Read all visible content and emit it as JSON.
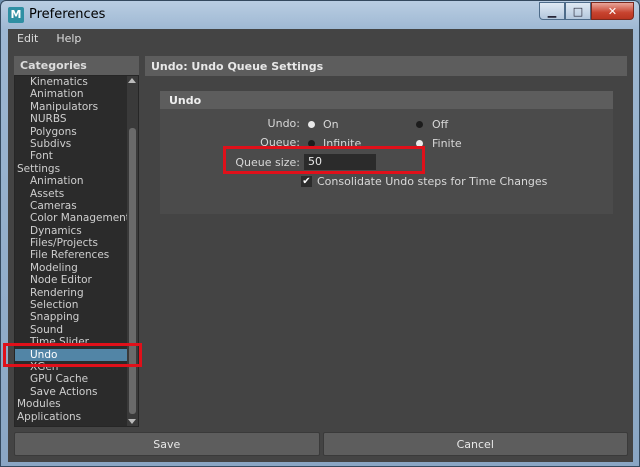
{
  "window": {
    "title": "Preferences",
    "app_icon_letter": "M",
    "buttons": {
      "minimize": "▁",
      "maximize": "□",
      "close": "✕"
    }
  },
  "menubar": {
    "items": [
      "Edit",
      "Help"
    ]
  },
  "categories": {
    "header": "Categories",
    "items": [
      {
        "label": "Kinematics",
        "level": 1
      },
      {
        "label": "Animation",
        "level": 1
      },
      {
        "label": "Manipulators",
        "level": 1
      },
      {
        "label": "NURBS",
        "level": 1
      },
      {
        "label": "Polygons",
        "level": 1
      },
      {
        "label": "Subdivs",
        "level": 1
      },
      {
        "label": "Font",
        "level": 1
      },
      {
        "label": "Settings",
        "level": 0
      },
      {
        "label": "Animation",
        "level": 1
      },
      {
        "label": "Assets",
        "level": 1
      },
      {
        "label": "Cameras",
        "level": 1
      },
      {
        "label": "Color Management",
        "level": 1
      },
      {
        "label": "Dynamics",
        "level": 1
      },
      {
        "label": "Files/Projects",
        "level": 1
      },
      {
        "label": "File References",
        "level": 1
      },
      {
        "label": "Modeling",
        "level": 1
      },
      {
        "label": "Node Editor",
        "level": 1
      },
      {
        "label": "Rendering",
        "level": 1
      },
      {
        "label": "Selection",
        "level": 1
      },
      {
        "label": "Snapping",
        "level": 1
      },
      {
        "label": "Sound",
        "level": 1
      },
      {
        "label": "Time Slider",
        "level": 1
      },
      {
        "label": "Undo",
        "level": 1,
        "selected": true
      },
      {
        "label": "XGen",
        "level": 1
      },
      {
        "label": "GPU Cache",
        "level": 1
      },
      {
        "label": "Save Actions",
        "level": 1
      },
      {
        "label": "Modules",
        "level": 0
      },
      {
        "label": "Applications",
        "level": 0
      }
    ]
  },
  "settings": {
    "header": "Undo: Undo Queue Settings",
    "frame_title": "Undo",
    "undo_label": "Undo:",
    "undo_on": "On",
    "undo_off": "Off",
    "undo_selected": "On",
    "queue_label": "Queue:",
    "queue_infinite": "Infinite",
    "queue_finite": "Finite",
    "queue_selected": "Finite",
    "queue_size_label": "Queue size:",
    "queue_size_value": "50",
    "consolidate_label": "Consolidate Undo steps for Time Changes",
    "consolidate_checked": true
  },
  "buttons": {
    "save": "Save",
    "cancel": "Cancel"
  },
  "colors": {
    "highlight": "#e0101a",
    "selection": "#5285a6"
  }
}
